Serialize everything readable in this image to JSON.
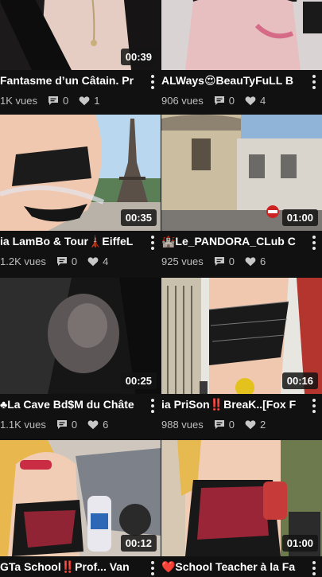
{
  "cards": [
    {
      "title": "Fantasme d’un Câtain. Pr",
      "duration": "00:39",
      "views": "1K vues",
      "comments": "0",
      "likes": "1"
    },
    {
      "title": "ALWays😍BeauTyFuLL B",
      "duration": "",
      "views": "906 vues",
      "comments": "0",
      "likes": "4"
    },
    {
      "title": "ia LamBo & Tour🗼EiffeL",
      "duration": "00:35",
      "views": "1.2K vues",
      "comments": "0",
      "likes": "4"
    },
    {
      "title": "🏰Le_PANDORA_CLub C",
      "duration": "01:00",
      "views": "925 vues",
      "comments": "0",
      "likes": "6"
    },
    {
      "title": "♣La Cave Bd$M du Châte",
      "duration": "00:25",
      "views": "1.1K vues",
      "comments": "0",
      "likes": "6"
    },
    {
      "title": "ia PriSon‼️BreaK..[Fox F",
      "duration": "00:16",
      "views": "988 vues",
      "comments": "0",
      "likes": "2"
    },
    {
      "title": "GTa School‼️Prof... Van",
      "duration": "00:12",
      "views": "",
      "comments": "",
      "likes": ""
    },
    {
      "title": "❤️School Teacher à la Fa",
      "duration": "01:00",
      "views": "",
      "comments": "",
      "likes": ""
    }
  ],
  "colors": {
    "background": "#111111",
    "meta_text": "#bdbdbd"
  },
  "icons": {
    "comment": "comment-icon",
    "like": "heart-icon",
    "menu": "more-vert-icon"
  }
}
